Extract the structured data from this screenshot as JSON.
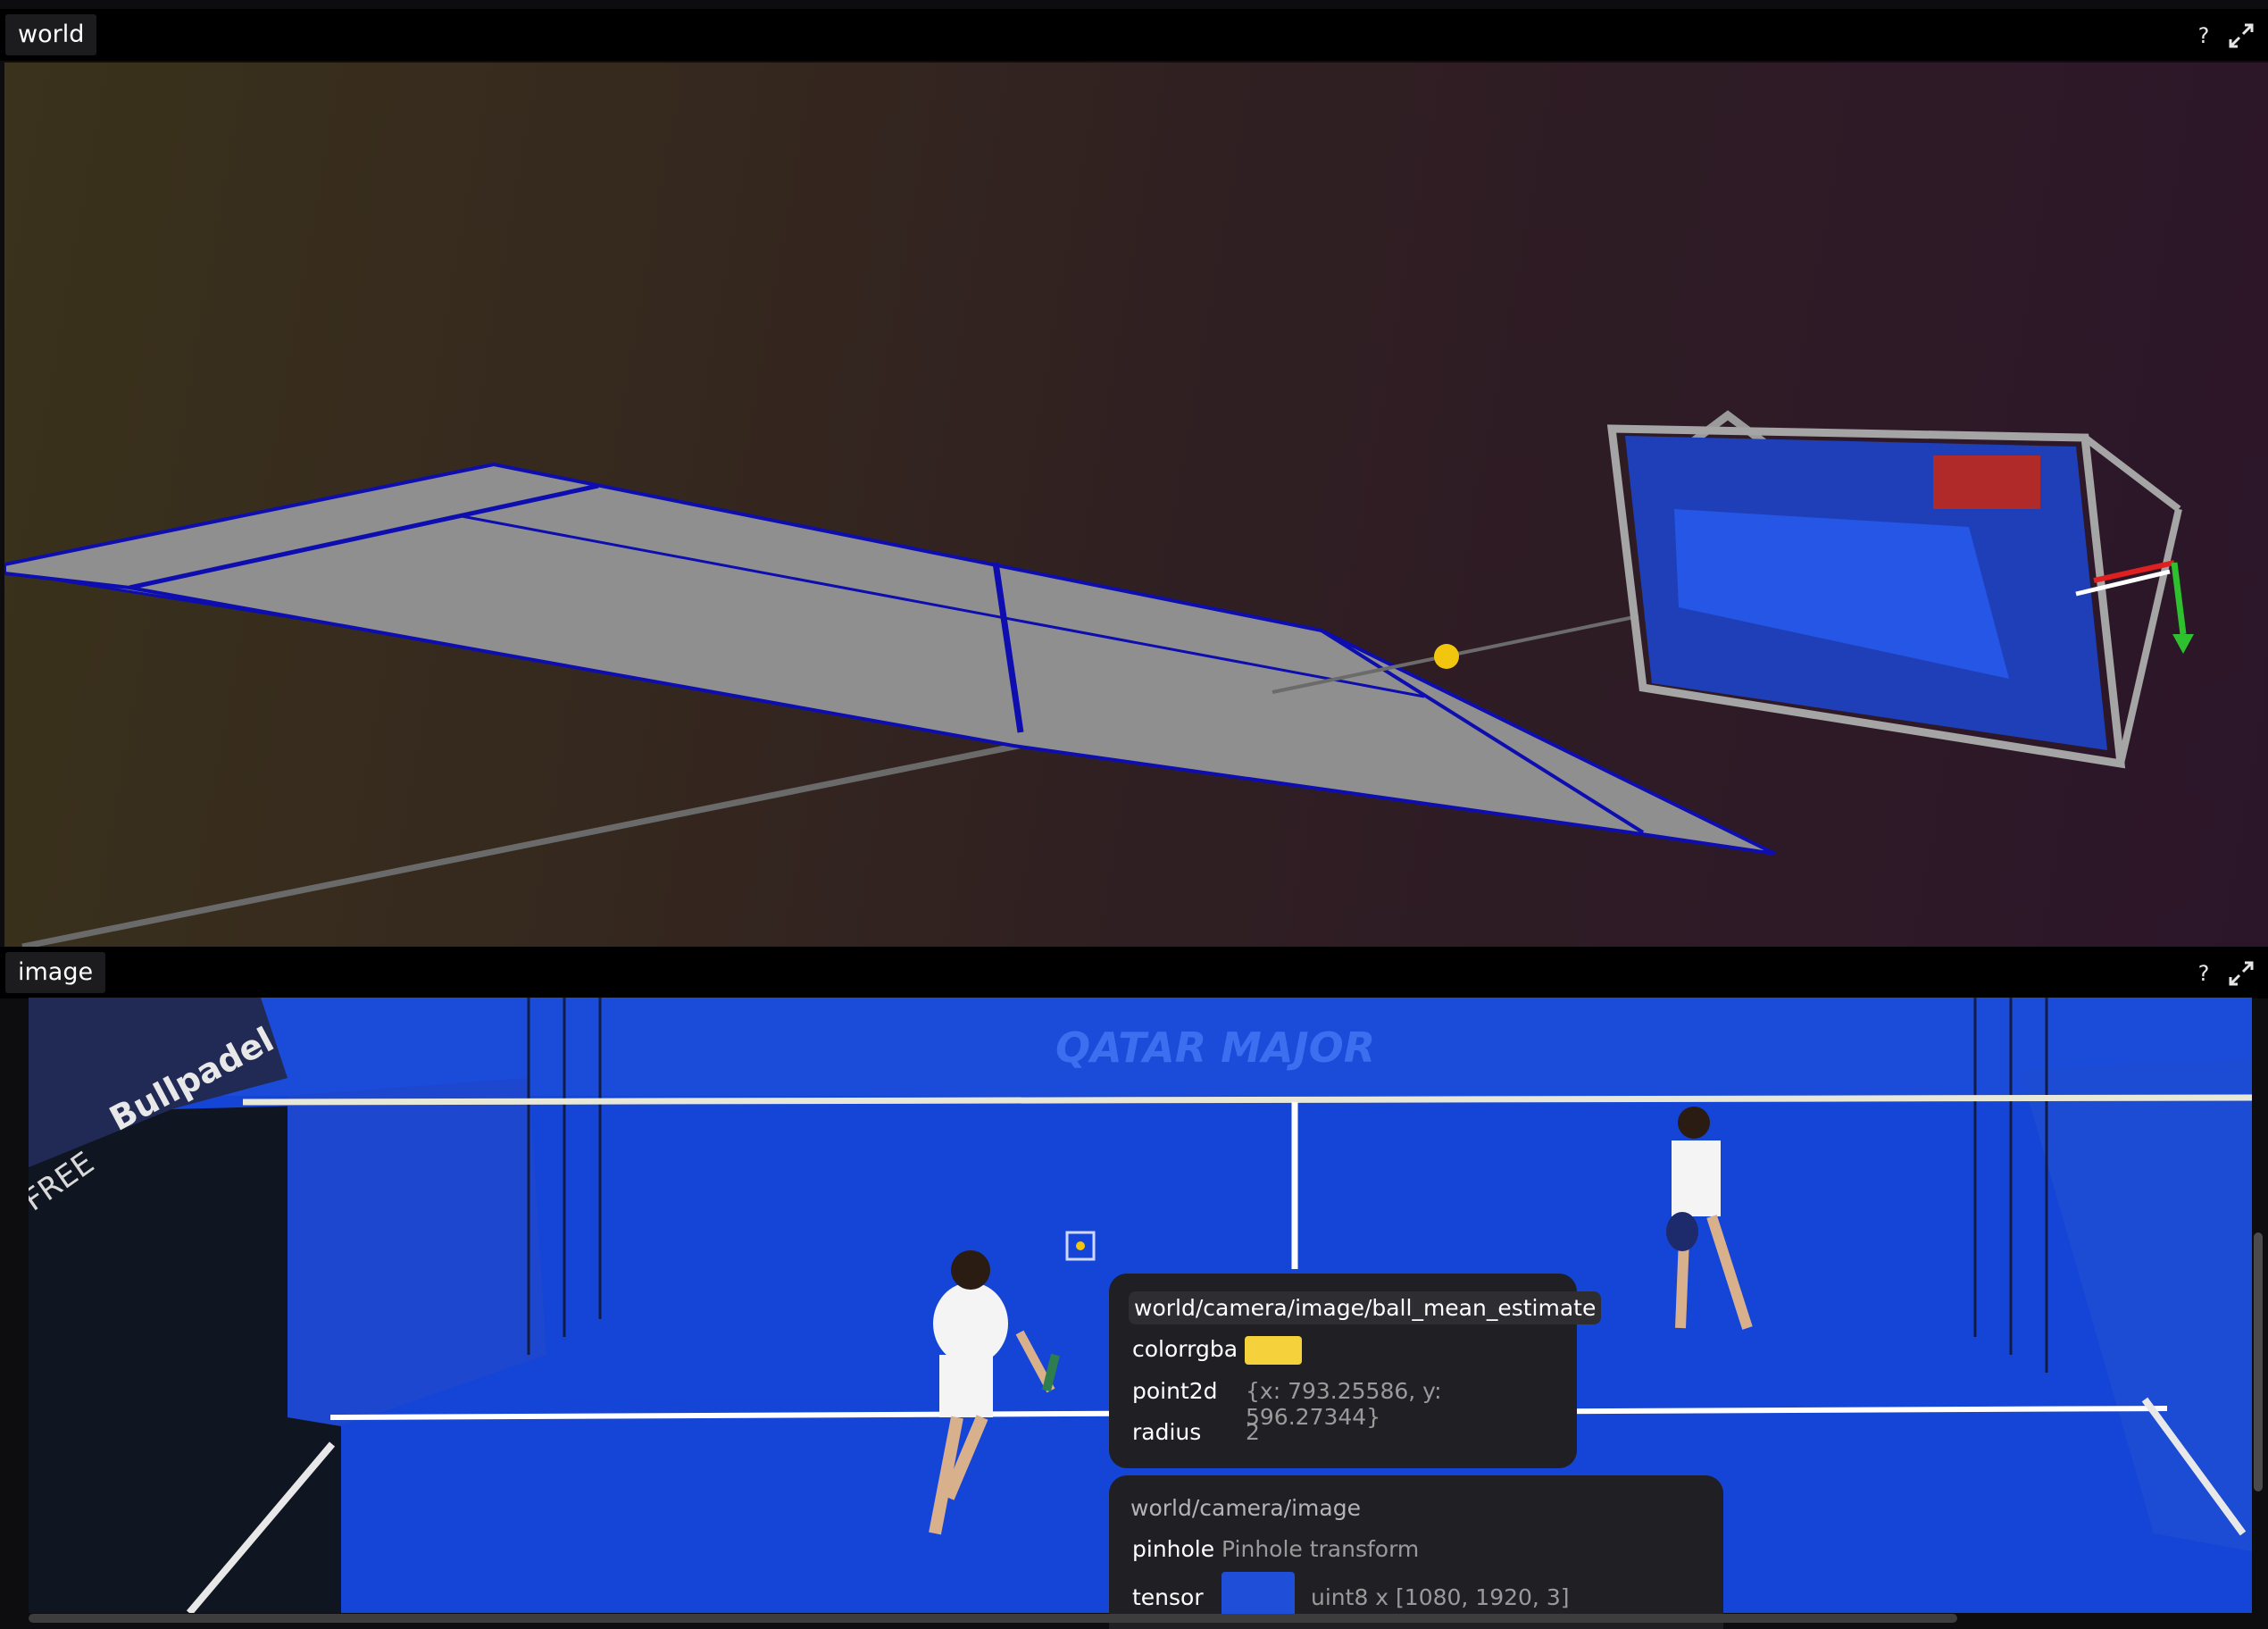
{
  "panels": {
    "world": {
      "title": "world",
      "help_label": "?",
      "maximize_icon": "maximize-icon"
    },
    "image": {
      "title": "image",
      "help_label": "?",
      "maximize_icon": "maximize-icon"
    }
  },
  "scene": {
    "court_color": "#8e8e8e",
    "line_color": "#0d0db0",
    "ball_color": "#f2c60f",
    "background_left": "#3a321c",
    "background_right": "#2b1529"
  },
  "image_view": {
    "court_color": "#1545d6",
    "banner_text": "QATAR MAJOR",
    "sponsor_text": "Bullpadel",
    "sign_text": "FREE",
    "point_marker_color": "#f2c60f"
  },
  "tooltip_entity": {
    "path": "world/camera/image/ball_mean_estimate",
    "rows": [
      {
        "key": "colorrgba",
        "value": "",
        "swatch": "#f5d23c"
      },
      {
        "key": "point2d",
        "value": "{x: 793.25586, y: 596.27344}"
      },
      {
        "key": "radius",
        "value": "2"
      }
    ]
  },
  "tooltip_parent": {
    "path": "world/camera/image",
    "rows": [
      {
        "key": "pinhole",
        "value": "Pinhole transform"
      },
      {
        "key": "tensor",
        "value": "uint8 x [1080, 1920, 3]"
      }
    ]
  }
}
